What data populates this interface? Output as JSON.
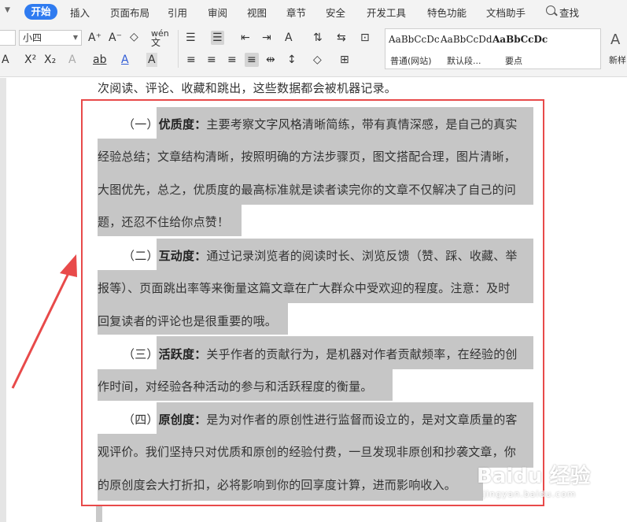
{
  "menu": {
    "active_tab": "开始",
    "tabs": [
      "插入",
      "页面布局",
      "引用",
      "审阅",
      "视图",
      "章节",
      "安全",
      "开发工具",
      "特色功能",
      "文档助手"
    ],
    "search_label": "查找"
  },
  "ribbon": {
    "font_size": "小四",
    "phonetic_label": "wén",
    "row1_buttons": [
      "A⁺",
      "A⁻",
      "◇",
      "A",
      "☰",
      "☰",
      "⇤",
      "⇥",
      "A",
      "↕",
      "⇆",
      "⊡"
    ],
    "row2_buttons": [
      "A",
      "X²",
      "X₂",
      "A",
      "ab",
      "A",
      "A"
    ],
    "styles": [
      {
        "sample": "AaBbCcDc",
        "name": "普通(网站)"
      },
      {
        "sample": "AaBbCcDd",
        "name": "默认段..."
      },
      {
        "sample": "AaBbCcDc",
        "name": "要点"
      }
    ],
    "new_style_label": "新样"
  },
  "document": {
    "top_line": "次阅读、评论、收藏和跳出，这些数据都会被机器记录。",
    "sections": [
      {
        "number": "（一）",
        "title": "优质度：",
        "lines": [
          "主要考察文字风格清晰简练，带有真情深感，是自己的真实",
          "经验总结；文章结构清晰，按照明确的方法步骤页，图文搭配合理，图片清晰，",
          "大图优先，总之，优质度的最高标准就是读者读完你的文章不仅解决了自己的问",
          "题，还忍不住给你点赞！"
        ]
      },
      {
        "number": "（二）",
        "title": "互动度：",
        "lines": [
          "通过记录浏览者的阅读时长、浏览反馈（赞、踩、收藏、举",
          "报等）、页面跳出率等来衡量这篇文章在广大群众中受欢迎的程度。注意：及时",
          "回复读者的评论也是很重要的哦。"
        ]
      },
      {
        "number": "（三）",
        "title": "活跃度：",
        "lines": [
          "关乎作者的贡献行为，是机器对作者贡献频率，在经验的创",
          "作时间，对经验各种活动的参与和活跃程度的衡量。"
        ]
      },
      {
        "number": "（四）",
        "title": "原创度：",
        "lines": [
          "是为对作者的原创性进行监督而设立的，是对文章质量的客",
          "观评价。我们坚持只对优质和原创的经验付费，一旦发现非原创和抄袭文章，你",
          "的原创度会大打折扣，必将影响到你的回享度计算，进而影响收入。"
        ]
      }
    ]
  },
  "watermark": {
    "main": "Baidu 经验",
    "sub": "jingyan.baidu.com"
  },
  "colors": {
    "accent": "#2f7bf0",
    "highlight": "#c6c6c6",
    "annotation_red": "#e84a4a"
  }
}
